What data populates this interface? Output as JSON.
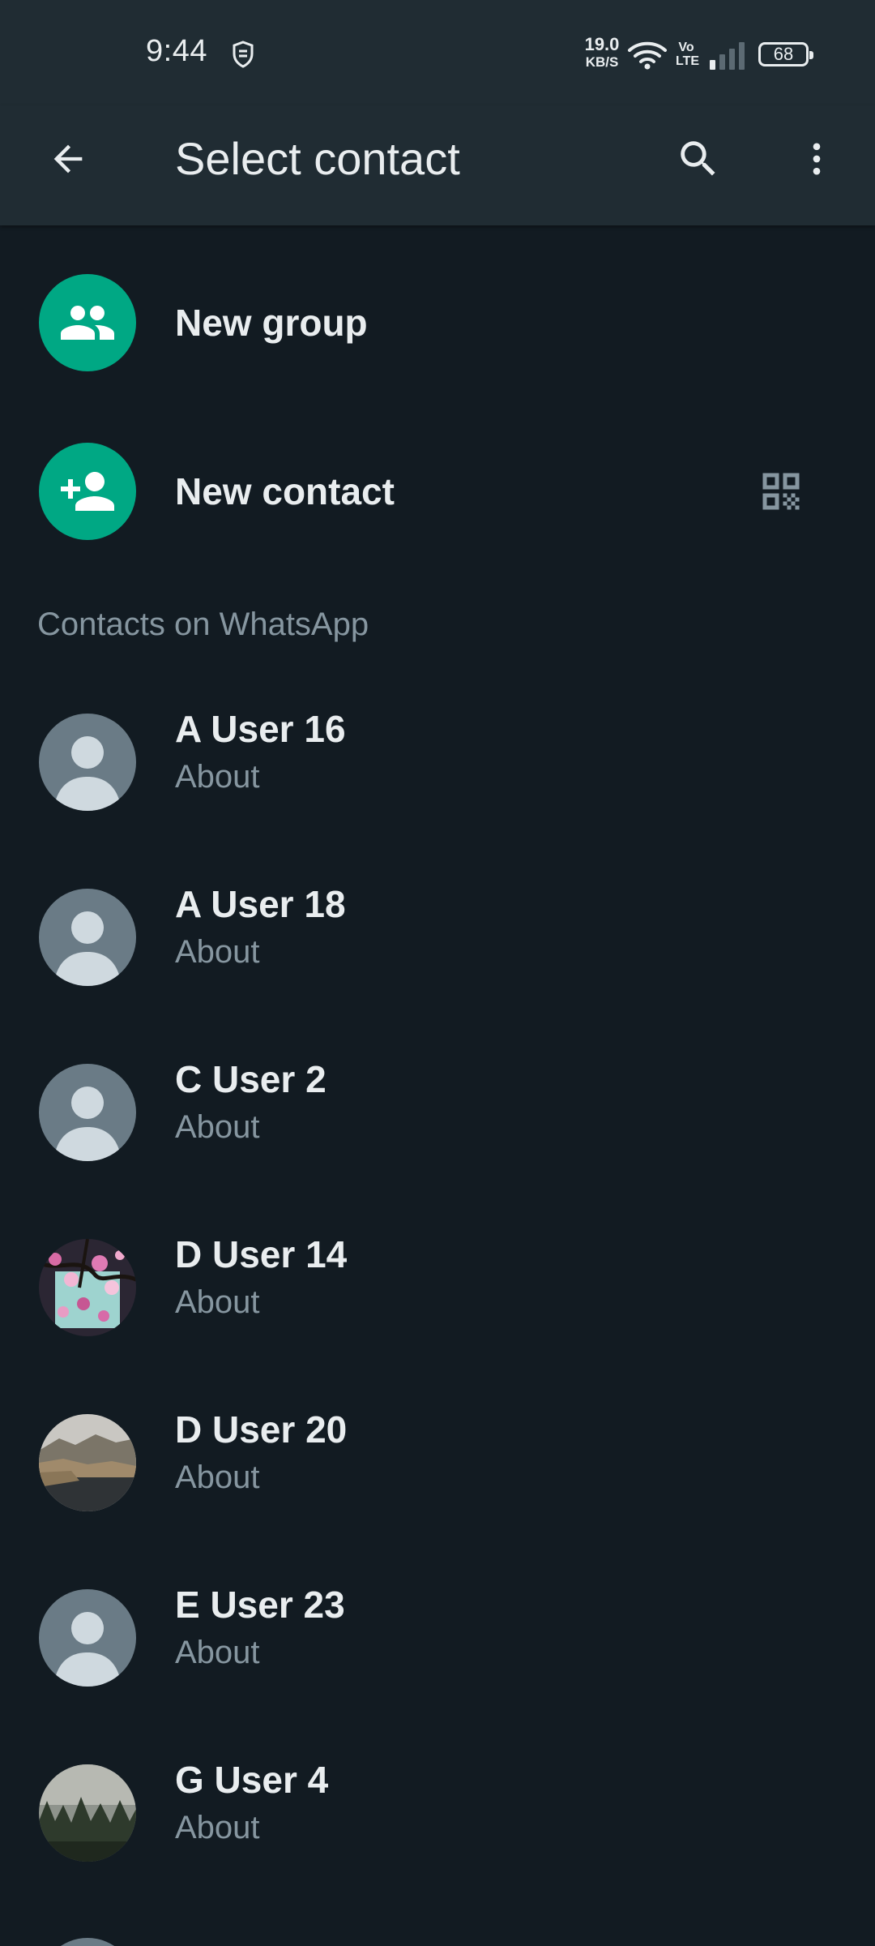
{
  "status_bar": {
    "time": "9:44",
    "speed_value": "19.0",
    "speed_unit": "KB/S",
    "network_label": "Vo LTE",
    "battery": "68"
  },
  "app_bar": {
    "title": "Select contact",
    "icons": [
      "back-arrow-icon",
      "search-icon",
      "more-vert-icon"
    ]
  },
  "actions": {
    "new_group_label": "New group",
    "new_contact_label": "New contact"
  },
  "section_header": "Contacts on WhatsApp",
  "contacts": [
    {
      "name": "A User 16",
      "about": "About",
      "avatar": "default"
    },
    {
      "name": "A User 18",
      "about": "About",
      "avatar": "default"
    },
    {
      "name": "C User 2",
      "about": "About",
      "avatar": "default"
    },
    {
      "name": "D User 14",
      "about": "About",
      "avatar": "flowers-photo"
    },
    {
      "name": "D User 20",
      "about": "About",
      "avatar": "coast-photo"
    },
    {
      "name": "E User 23",
      "about": "About",
      "avatar": "default"
    },
    {
      "name": "G User 4",
      "about": "About",
      "avatar": "forest-photo"
    }
  ],
  "colors": {
    "background": "#121b22",
    "header": "#202c33",
    "accent": "#00a884",
    "primary_text": "#e9edef",
    "secondary_text": "#8696a0",
    "default_avatar": "#6a7b86"
  }
}
